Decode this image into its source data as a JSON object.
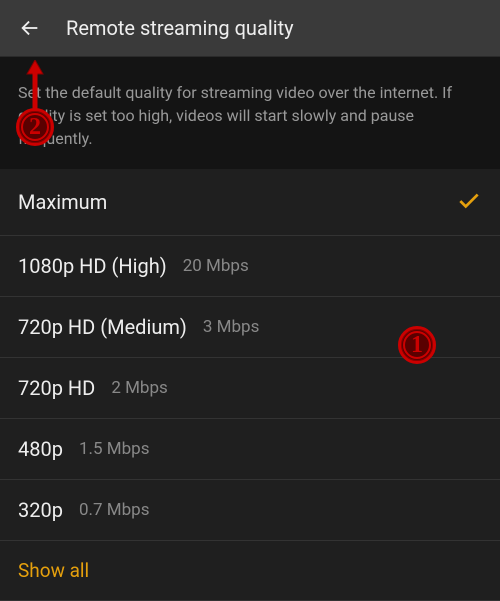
{
  "header": {
    "title": "Remote streaming quality"
  },
  "description": "Set the default quality for streaming video over the internet. If quality is set too high, videos will start slowly and pause frequently.",
  "options": [
    {
      "label": "Maximum",
      "detail": "",
      "selected": true
    },
    {
      "label": "1080p HD (High)",
      "detail": "20 Mbps",
      "selected": false
    },
    {
      "label": "720p HD (Medium)",
      "detail": "3 Mbps",
      "selected": false
    },
    {
      "label": "720p HD",
      "detail": "2 Mbps",
      "selected": false
    },
    {
      "label": "480p",
      "detail": "1.5 Mbps",
      "selected": false
    },
    {
      "label": "320p",
      "detail": "0.7 Mbps",
      "selected": false
    }
  ],
  "show_all_label": "Show all",
  "annotations": {
    "marker1": "1",
    "marker2": "2"
  },
  "colors": {
    "accent": "#e5a00d",
    "annotation": "#c00"
  }
}
